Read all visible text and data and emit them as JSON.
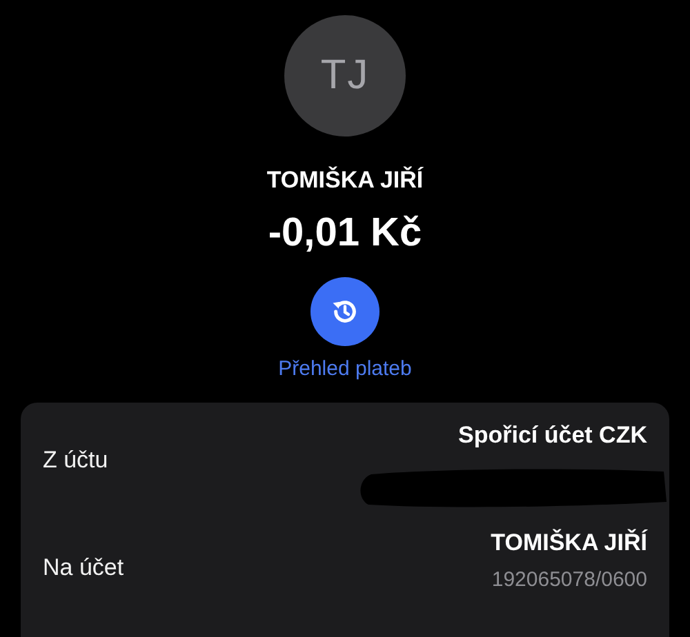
{
  "avatar": {
    "initials": "TJ"
  },
  "name": "TOMIŠKA JIŘÍ",
  "amount": "-0,01 Kč",
  "history": {
    "label": "Přehled plateb"
  },
  "details": [
    {
      "label": "Z účtu",
      "value": "Spořicí účet CZK",
      "redacted": true
    },
    {
      "label": "Na účet",
      "value": "TOMIŠKA JIŘÍ",
      "sub": "192065078/0600"
    }
  ]
}
